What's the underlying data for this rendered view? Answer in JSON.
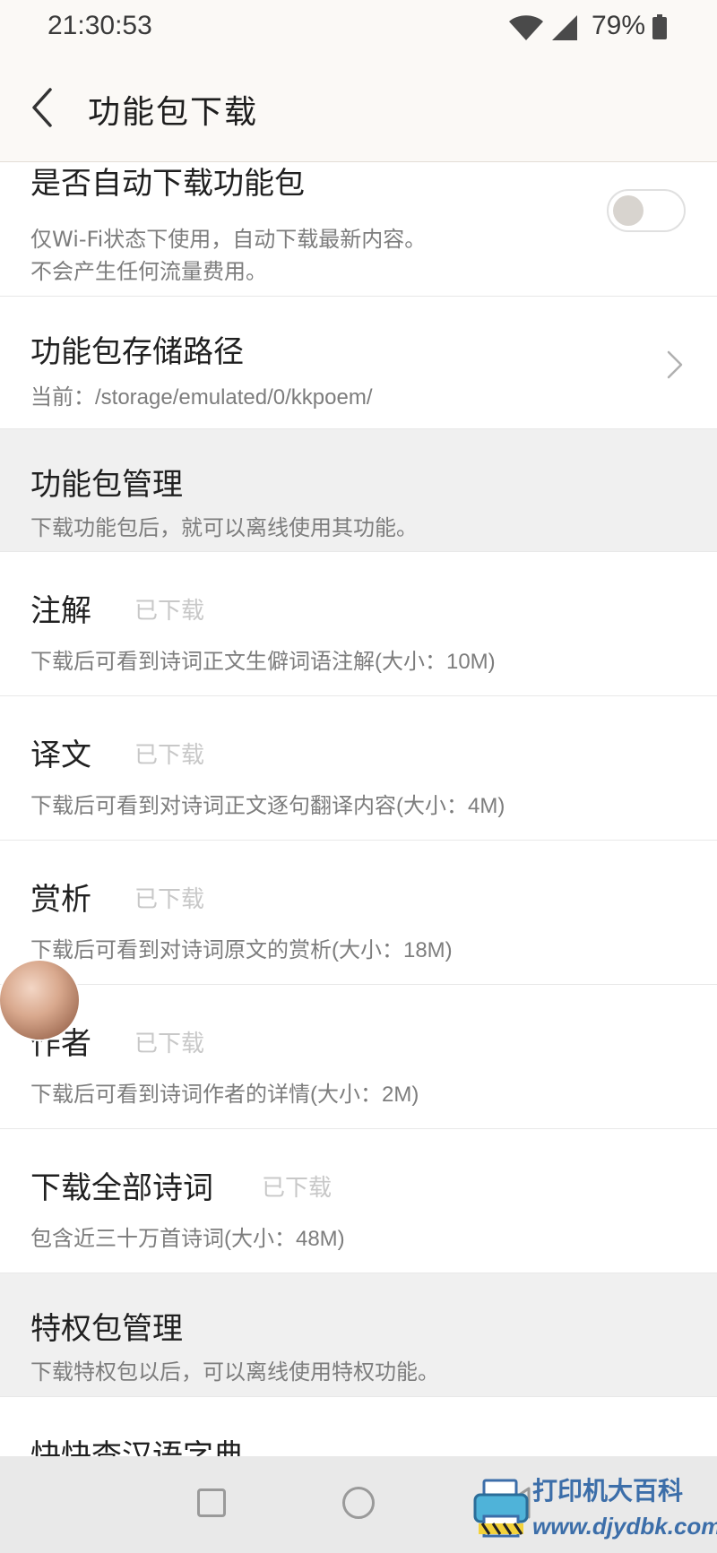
{
  "status_bar": {
    "time": "21:30:53",
    "battery_percent": "79%",
    "wifi_icon": "wifi-icon",
    "signal_icon": "cell-signal-icon",
    "battery_icon": "battery-icon"
  },
  "header": {
    "title": "功能包下载",
    "back_icon": "back-arrow-icon"
  },
  "settings": {
    "auto_download": {
      "title": "是否自动下载功能包",
      "desc_line1": "仅Wi-Fi状态下使用，自动下载最新内容。",
      "desc_line2": "不会产生任何流量费用。",
      "enabled": false
    },
    "storage_path": {
      "title": "功能包存储路径",
      "desc": "当前：/storage/emulated/0/kkpoem/"
    }
  },
  "package_section": {
    "title": "功能包管理",
    "desc": "下载功能包后，就可以离线使用其功能。",
    "items": [
      {
        "title": "注解",
        "status": "已下载",
        "desc": "下载后可看到诗词正文生僻词语注解(大小：10M)"
      },
      {
        "title": "译文",
        "status": "已下载",
        "desc": "下载后可看到对诗词正文逐句翻译内容(大小：4M)"
      },
      {
        "title": "赏析",
        "status": "已下载",
        "desc": "下载后可看到对诗词原文的赏析(大小：18M)"
      },
      {
        "title": "作者",
        "status": "已下载",
        "desc": "下载后可看到诗词作者的详情(大小：2M)"
      },
      {
        "title": "下载全部诗词",
        "status": "已下载",
        "desc": "包含近三十万首诗词(大小：48M)"
      }
    ]
  },
  "privilege_section": {
    "title": "特权包管理",
    "desc": "下载特权包以后，可以离线使用特权功能。",
    "next_item_title": "快快查汉语字典"
  },
  "watermark": {
    "text": "打印机大百科",
    "url": "www.djydbk.com"
  },
  "colors": {
    "header_bg": "#fbf9f6",
    "section_bg": "#f0f0f0",
    "status_gray": "#c8c8c8",
    "watermark_blue": "#3c6ea9"
  }
}
